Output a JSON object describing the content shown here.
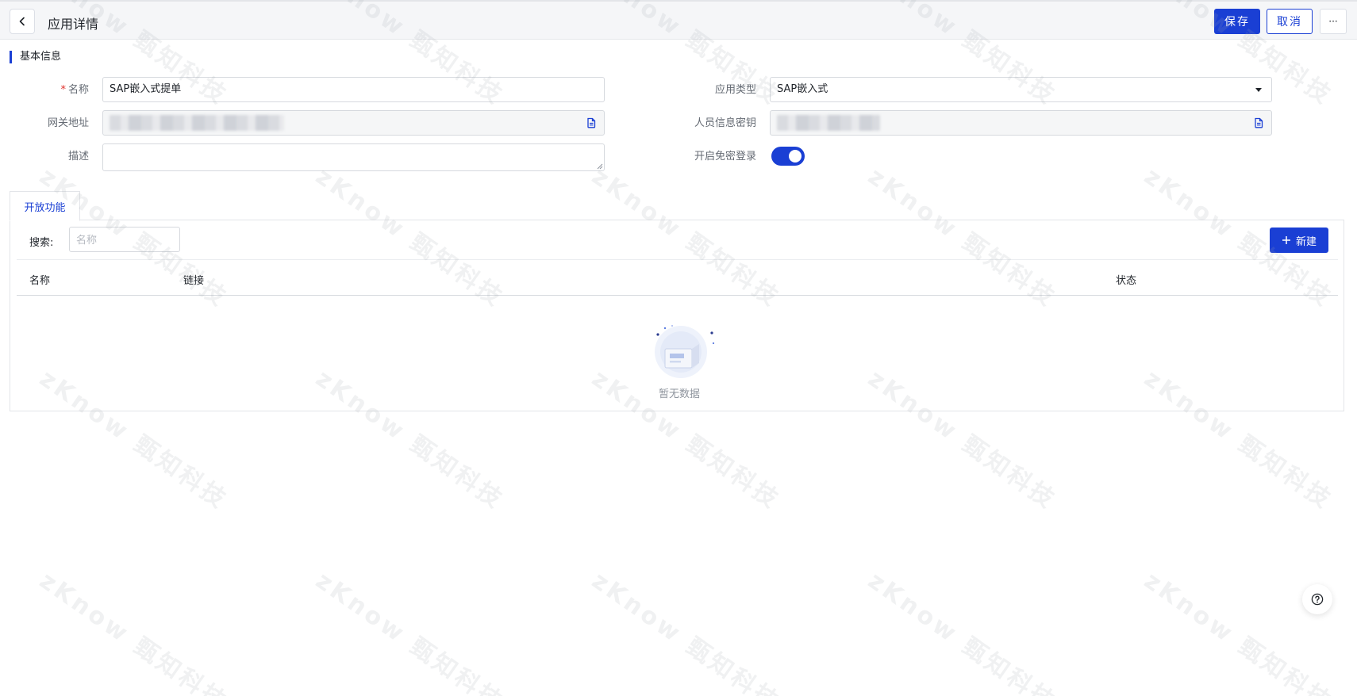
{
  "header": {
    "title": "应用详情",
    "save_label": "保存",
    "cancel_label": "取消",
    "more_label": "···"
  },
  "basic_info": {
    "section_title": "基本信息",
    "name": {
      "label": "名称",
      "required_mark": "*",
      "value": "SAP嵌入式提单"
    },
    "app_type": {
      "label": "应用类型",
      "value": "SAP嵌入式"
    },
    "gateway": {
      "label": "网关地址"
    },
    "personnel_key": {
      "label": "人员信息密钥"
    },
    "description": {
      "label": "描述",
      "value": ""
    },
    "passwordless": {
      "label": "开启免密登录",
      "enabled": true
    }
  },
  "tabs": [
    {
      "label": "开放功能",
      "active": true
    }
  ],
  "functions": {
    "search_label": "搜索:",
    "search_placeholder": "名称",
    "new_label": "新建",
    "columns": [
      "名称",
      "链接",
      "状态"
    ],
    "rows": [],
    "empty_text": "暂无数据"
  },
  "watermark": {
    "text": "zKnow 甄知科技"
  },
  "colors": {
    "primary": "#1a3fd4",
    "required": "#e0302b"
  },
  "icons": {
    "back": "chevron-left-icon",
    "copy": "copy-icon",
    "plus": "plus-icon",
    "help": "question-circle-icon",
    "empty": "empty-box-icon"
  }
}
